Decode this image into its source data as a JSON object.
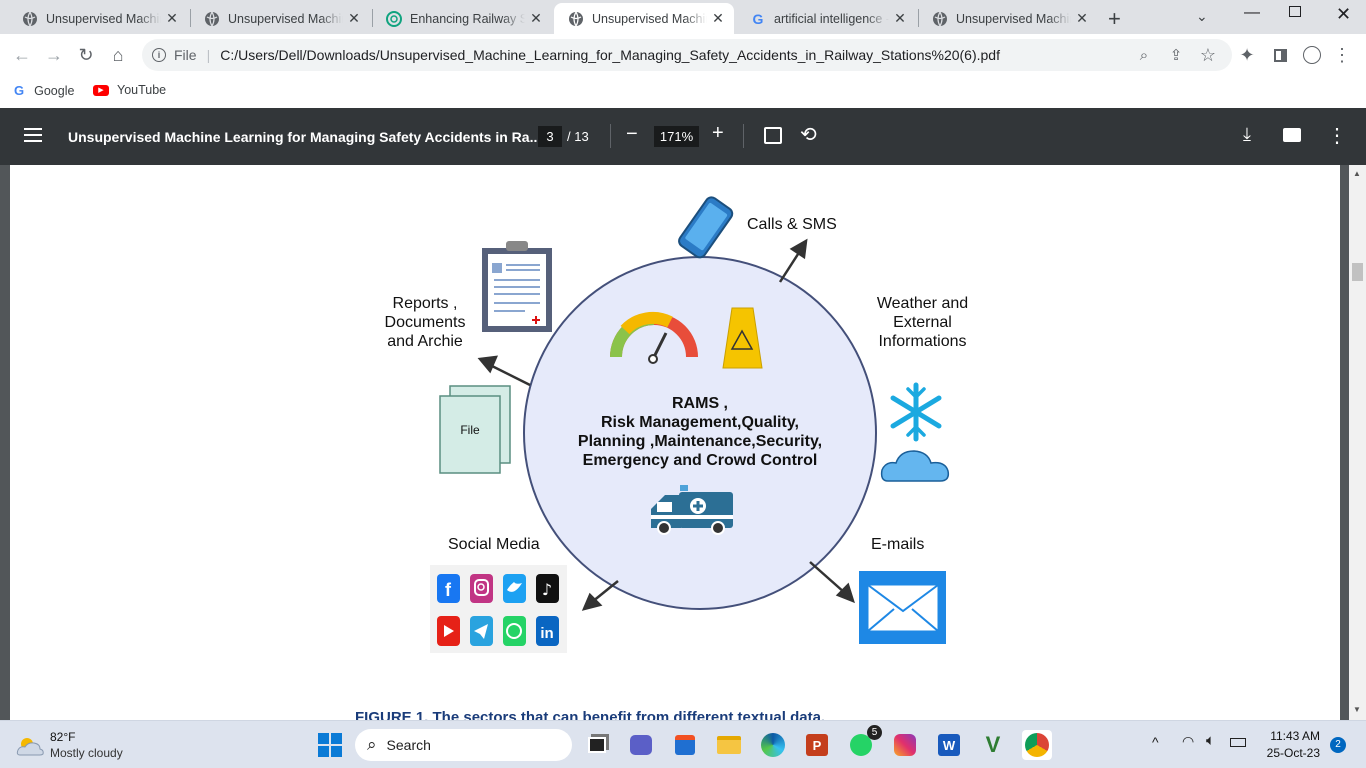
{
  "browser": {
    "tabs": [
      {
        "title": "Unsupervised Machin",
        "icon": "globe-icon"
      },
      {
        "title": "Unsupervised Machin",
        "icon": "globe-icon"
      },
      {
        "title": "Enhancing Railway Sa",
        "icon": "chatgpt-icon"
      },
      {
        "title": "Unsupervised Machin",
        "icon": "globe-icon",
        "active": true
      },
      {
        "title": "artificial intelligence -",
        "icon": "google-icon"
      },
      {
        "title": "Unsupervised Machin",
        "icon": "globe-icon"
      }
    ],
    "address": {
      "scheme_label": "File",
      "url": "C:/Users/Dell/Downloads/Unsupervised_Machine_Learning_for_Managing_Safety_Accidents_in_Railway_Stations%20(6).pdf"
    },
    "bookmarks": [
      {
        "label": "Google",
        "icon": "google-icon"
      },
      {
        "label": "YouTube",
        "icon": "youtube-icon"
      }
    ]
  },
  "pdf": {
    "title": "Unsupervised Machine Learning for Managing Safety Accidents in Ra...",
    "page_current": "3",
    "page_total": "/ 13",
    "zoom": "171%"
  },
  "figure": {
    "center_lines": [
      "RAMS ,",
      "Risk Management,Quality,",
      "Planning ,Maintenance,Security,",
      "Emergency and Crowd Control"
    ],
    "calls": "Calls & SMS",
    "weather_lines": [
      "Weather and",
      "External",
      "Informations"
    ],
    "reports_lines": [
      "Reports ,",
      "Documents",
      "and Archie"
    ],
    "file": "File",
    "social": "Social Media",
    "emails": "E-mails",
    "caption": "FIGURE 1.  The sectors that can benefit from different textual data."
  },
  "taskbar": {
    "weather_temp": "82°F",
    "weather_desc": "Mostly cloudy",
    "search_label": "Search",
    "whatsapp_badge": "5",
    "time": "11:43 AM",
    "date": "25-Oct-23",
    "notification_count": "2"
  }
}
